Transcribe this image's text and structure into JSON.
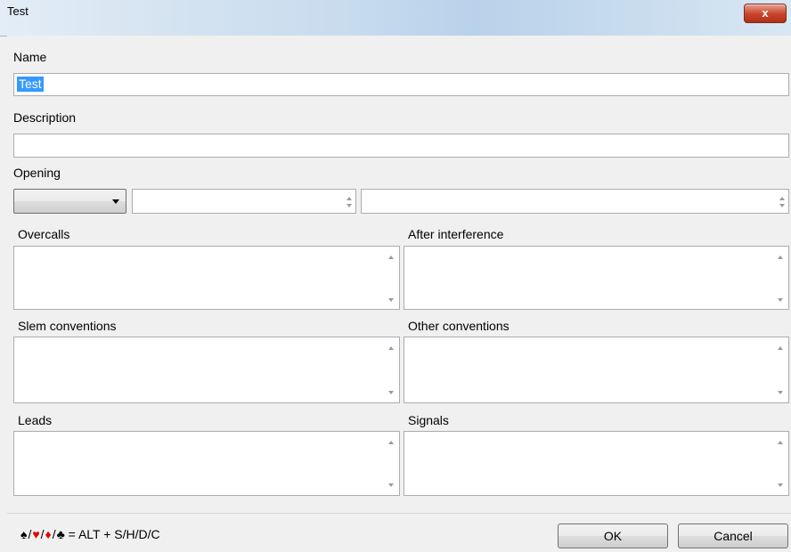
{
  "window": {
    "title": "Test",
    "close_label": "x"
  },
  "form": {
    "name_label": "Name",
    "name_value": "Test",
    "description_label": "Description",
    "description_value": "",
    "opening_label": "Opening",
    "opening_select_value": "",
    "opening_field1_value": "",
    "opening_field2_value": "",
    "overcalls_label": "Overcalls",
    "after_interference_label": "After interference",
    "slem_conventions_label": "Slem conventions",
    "other_conventions_label": "Other conventions",
    "leads_label": "Leads",
    "signals_label": "Signals"
  },
  "footer": {
    "suits": {
      "spade": "♠",
      "heart": "♥",
      "diamond": "♦",
      "club": "♣",
      "separator": "/"
    },
    "shortcut_text": "= ALT + S/H/D/C",
    "ok_label": "OK",
    "cancel_label": "Cancel"
  },
  "colors": {
    "selection": "#3399ff",
    "red_suit": "#e00000",
    "close_button": "#c7432a"
  }
}
